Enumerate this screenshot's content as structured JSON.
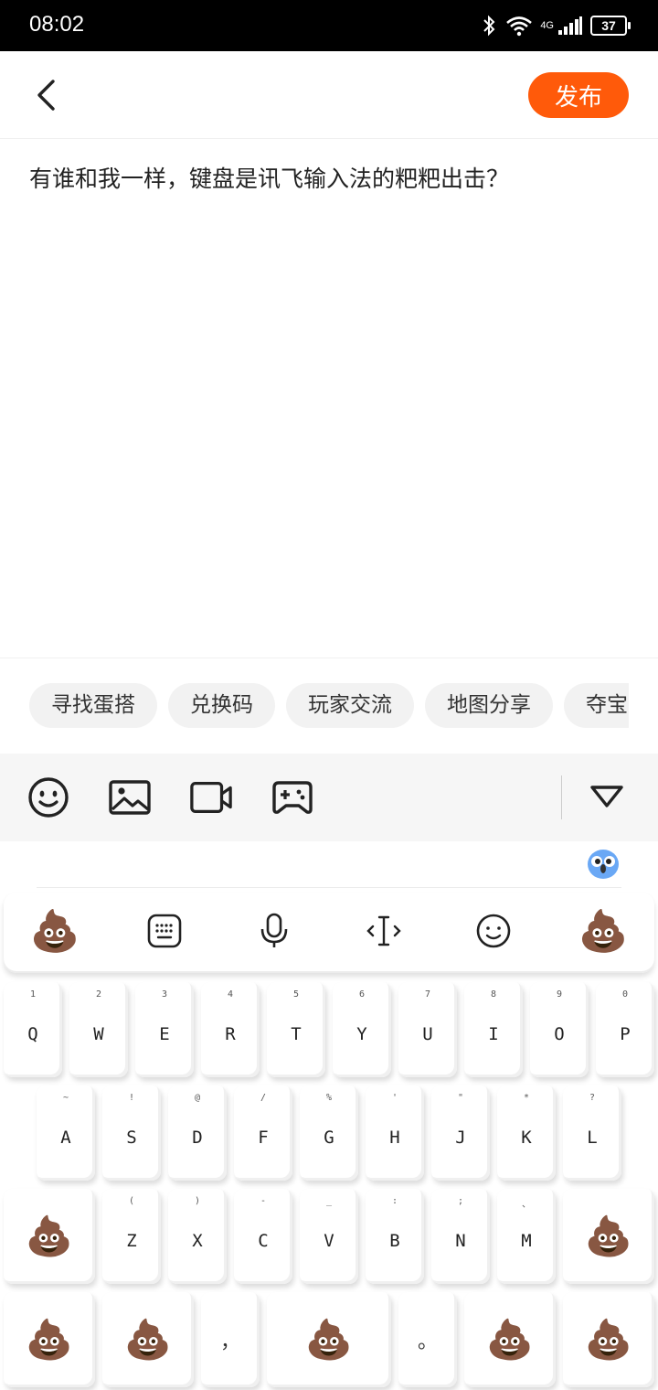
{
  "status_bar": {
    "time": "08:02",
    "network": "4G",
    "battery": "37"
  },
  "header": {
    "publish_label": "发布"
  },
  "post": {
    "text": "有谁和我一样，键盘是讯飞输入法的粑粑出击？"
  },
  "chips": [
    "寻找蛋搭",
    "兑换码",
    "玩家交流",
    "地图分享",
    "夺宝"
  ],
  "toolbar": {
    "icons": [
      "emoji-icon",
      "image-icon",
      "video-icon",
      "gamepad-icon",
      "collapse-icon"
    ]
  },
  "keyboard": {
    "poop": "💩",
    "row1": [
      {
        "hint": "1",
        "key": "Q"
      },
      {
        "hint": "2",
        "key": "W"
      },
      {
        "hint": "3",
        "key": "E"
      },
      {
        "hint": "4",
        "key": "R"
      },
      {
        "hint": "5",
        "key": "T"
      },
      {
        "hint": "6",
        "key": "Y"
      },
      {
        "hint": "7",
        "key": "U"
      },
      {
        "hint": "8",
        "key": "I"
      },
      {
        "hint": "9",
        "key": "O"
      },
      {
        "hint": "0",
        "key": "P"
      }
    ],
    "row2": [
      {
        "hint": "~",
        "key": "A"
      },
      {
        "hint": "!",
        "key": "S"
      },
      {
        "hint": "@",
        "key": "D"
      },
      {
        "hint": "/",
        "key": "F"
      },
      {
        "hint": "%",
        "key": "G"
      },
      {
        "hint": "'",
        "key": "H"
      },
      {
        "hint": "\"",
        "key": "J"
      },
      {
        "hint": "*",
        "key": "K"
      },
      {
        "hint": "?",
        "key": "L"
      }
    ],
    "row3": [
      {
        "hint": "(",
        "key": "Z"
      },
      {
        "hint": ")",
        "key": "X"
      },
      {
        "hint": "-",
        "key": "C"
      },
      {
        "hint": "_",
        "key": "V"
      },
      {
        "hint": ":",
        "key": "B"
      },
      {
        "hint": ";",
        "key": "N"
      },
      {
        "hint": "、",
        "key": "M"
      }
    ],
    "comma": "，",
    "period": "。"
  }
}
